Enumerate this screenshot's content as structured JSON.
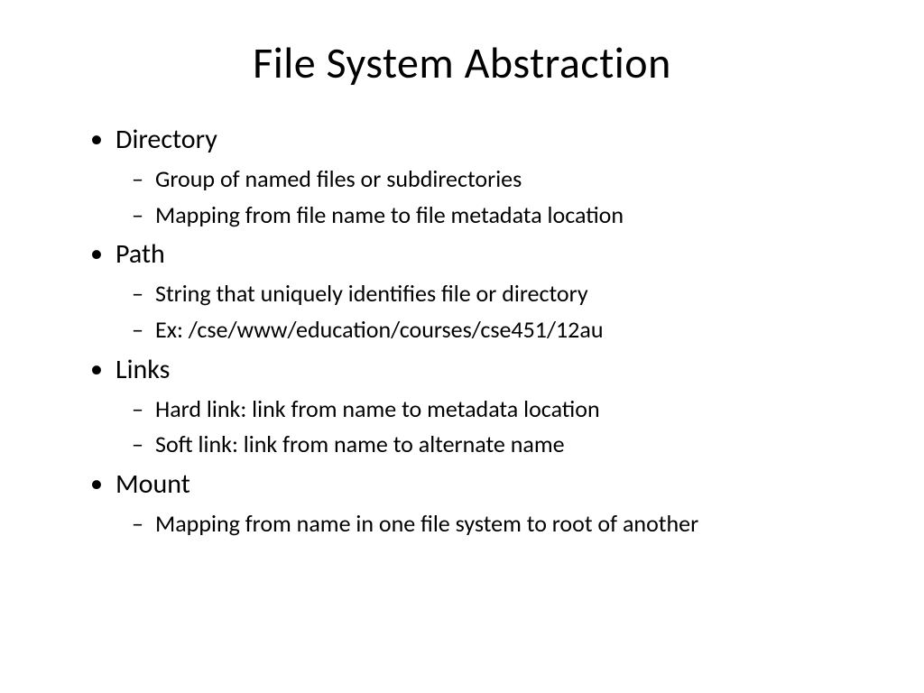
{
  "slide": {
    "title": "File System Abstraction",
    "bullets": [
      {
        "label": "Directory",
        "subitems": [
          "Group of named files or subdirectories",
          "Mapping from file name to file metadata location"
        ]
      },
      {
        "label": "Path",
        "subitems": [
          "String that uniquely identifies file or directory",
          "Ex: /cse/www/education/courses/cse451/12au"
        ]
      },
      {
        "label": "Links",
        "subitems": [
          "Hard link: link from name to metadata location",
          "Soft link: link from name to alternate name"
        ]
      },
      {
        "label": "Mount",
        "subitems": [
          "Mapping from name in one file system to root of another"
        ]
      }
    ]
  }
}
